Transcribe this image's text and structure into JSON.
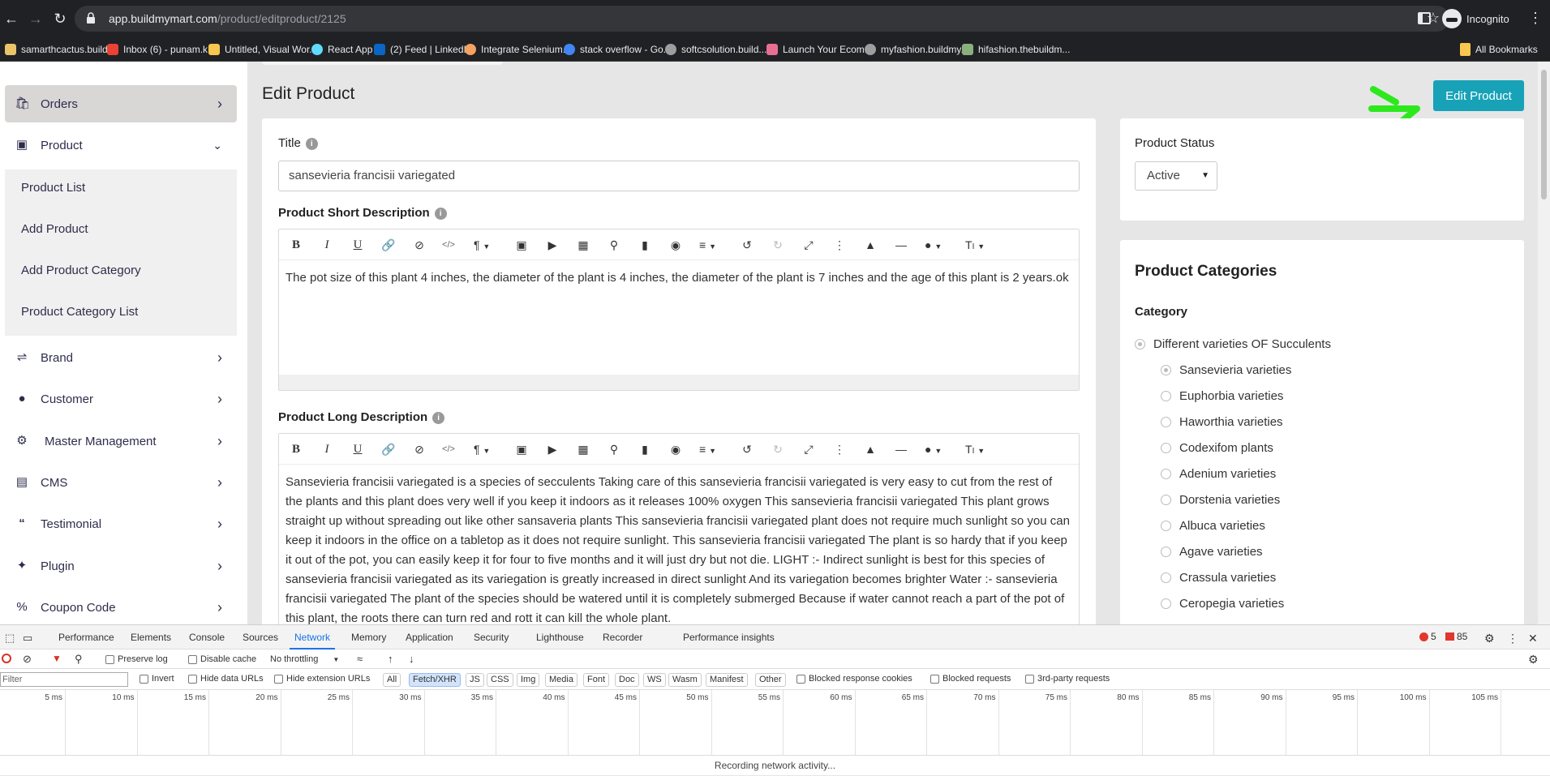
{
  "browser": {
    "url_domain": "app.buildmymart.com",
    "url_path": "/product/editproduct/2125",
    "profile": "Incognito",
    "bookmarks": [
      {
        "label": "samarthcactus.build...",
        "color": "#e9c46a"
      },
      {
        "label": "Inbox (6) - punam.k...",
        "color": "#ea4335"
      },
      {
        "label": "Untitled, Visual Wor...",
        "color": "#f9c74f"
      },
      {
        "label": "React App",
        "color": "#61dafb"
      },
      {
        "label": "(2) Feed | LinkedIn",
        "color": "#0a66c2"
      },
      {
        "label": "Integrate Selenium...",
        "color": "#f4a261"
      },
      {
        "label": "stack overflow - Go...",
        "color": "#4285f4"
      },
      {
        "label": "softcsolution.build...",
        "color": "#9e9e9e"
      },
      {
        "label": "Launch Your Ecom...",
        "color": "#e76f93"
      },
      {
        "label": "myfashion.buildmy...",
        "color": "#9e9e9e"
      },
      {
        "label": "hifashion.thebuildm...",
        "color": "#8ab17d"
      }
    ],
    "all_bookmarks": "All Bookmarks"
  },
  "sidebar": {
    "items": [
      {
        "label": "Orders",
        "icon": "shopping-bag-icon"
      },
      {
        "label": "Product",
        "icon": "archive-icon"
      },
      {
        "label": "Brand",
        "icon": "shuffle-icon"
      },
      {
        "label": "Customer",
        "icon": "user-icon"
      },
      {
        "label": "Master Management",
        "icon": "user-cog-icon"
      },
      {
        "label": "CMS",
        "icon": "file-icon"
      },
      {
        "label": "Testimonial",
        "icon": "quote-icon"
      },
      {
        "label": "Plugin",
        "icon": "puzzle-icon"
      },
      {
        "label": "Coupon Code",
        "icon": "percent-icon"
      }
    ],
    "product_submenu": [
      "Product List",
      "Add Product",
      "Add Product Category",
      "Product Category List"
    ]
  },
  "main": {
    "page_title": "Edit Product",
    "edit_button": "Edit Product",
    "title_label": "Title",
    "title_value": "sansevieria francisii variegated",
    "short_desc_label": "Product Short Description",
    "short_desc_text": "The pot size of this plant 4 inches, the diameter of the plant is 4 inches, the diameter of the plant is 7 inches and the age of this plant is 2 years.ok",
    "long_desc_label": "Product Long Description",
    "long_desc_text": "Sansevieria francisii variegated is a species of secculents Taking care of this sansevieria francisii variegated is very easy to cut from the rest of the plants and this plant does very well if you keep it indoors as it releases 100% oxygen This sansevieria francisii variegated This plant grows straight up without spreading out like other sansaveria plants This sansevieria francisii variegated plant does not require much sunlight so you can keep it indoors in the office on a tabletop as it does not require sunlight. This sansevieria francisii variegated The plant is so hardy that if you keep it out of the pot, you can easily keep it for four to five months and it will just dry but not die. LIGHT :- Indirect sunlight is best for this species of sansevieria francisii variegated as its variegation is greatly increased in direct sunlight And its variegation becomes brighter Water :- sansevieria francisii variegated The plant of the species should be watered until it is completely submerged Because if water cannot reach a part of the pot of this plant, the roots there can turn red and rott it can kill the whole plant.",
    "status_label": "Product Status",
    "status_value": "Active",
    "categories_title": "Product Categories",
    "category_label": "Category",
    "parent_category": "Different varieties OF Succulents",
    "subcategories": [
      {
        "label": "Sansevieria varieties",
        "checked": true
      },
      {
        "label": "Euphorbia varieties",
        "checked": false
      },
      {
        "label": "Haworthia varieties",
        "checked": false
      },
      {
        "label": "Codexifom plants",
        "checked": false
      },
      {
        "label": "Adenium varieties",
        "checked": false
      },
      {
        "label": "Dorstenia varieties",
        "checked": false
      },
      {
        "label": "Albuca varieties",
        "checked": false
      },
      {
        "label": "Agave varieties",
        "checked": false
      },
      {
        "label": "Crassula varieties",
        "checked": false
      },
      {
        "label": "Ceropegia varieties",
        "checked": false
      }
    ]
  },
  "devtools": {
    "tabs": [
      "Performance",
      "Elements",
      "Console",
      "Sources",
      "Network",
      "Memory",
      "Application",
      "Security",
      "Lighthouse",
      "Recorder",
      "Performance insights"
    ],
    "active_tab": "Network",
    "errors": "5",
    "warnings": "85",
    "preserve_log": "Preserve log",
    "disable_cache": "Disable cache",
    "throttling": "No throttling",
    "filter_placeholder": "Filter",
    "invert": "Invert",
    "hide_data_urls": "Hide data URLs",
    "hide_extension_urls": "Hide extension URLs",
    "type_filters": [
      "All",
      "Fetch/XHR",
      "JS",
      "CSS",
      "Img",
      "Media",
      "Font",
      "Doc",
      "WS",
      "Wasm",
      "Manifest",
      "Other"
    ],
    "active_type": "Fetch/XHR",
    "blocked_cookies": "Blocked response cookies",
    "blocked_requests": "Blocked requests",
    "third_party": "3rd-party requests",
    "timeline_ticks": [
      "5 ms",
      "10 ms",
      "15 ms",
      "20 ms",
      "25 ms",
      "30 ms",
      "35 ms",
      "40 ms",
      "45 ms",
      "50 ms",
      "55 ms",
      "60 ms",
      "65 ms",
      "70 ms",
      "75 ms",
      "80 ms",
      "85 ms",
      "90 ms",
      "95 ms",
      "100 ms",
      "105 ms"
    ],
    "status_text": "Recording network activity..."
  }
}
